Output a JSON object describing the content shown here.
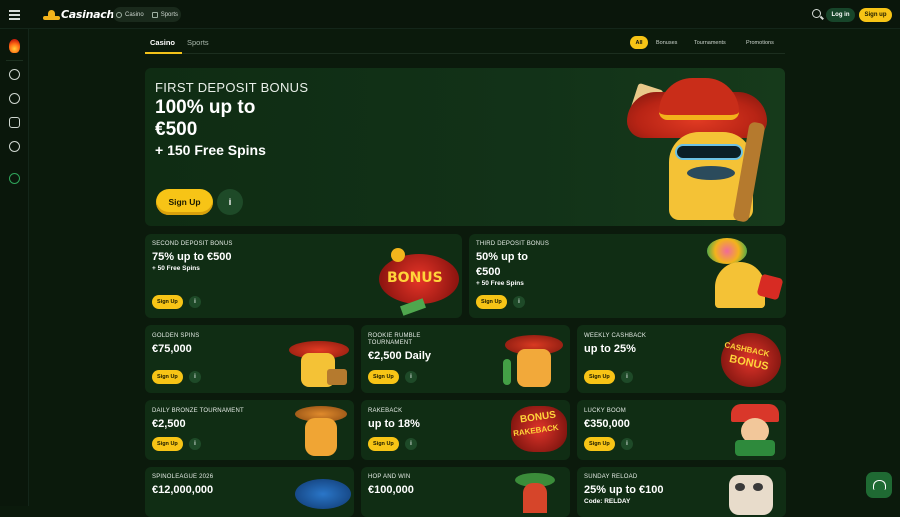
{
  "topbar": {
    "logo_text": "Casinacho",
    "seg_casino": "Casino",
    "seg_sports": "Sports",
    "login_label": "Log in",
    "signup_label": "Sign up"
  },
  "subnav": {
    "tab_casino": "Casino",
    "tab_sports": "Sports",
    "filters": [
      "All",
      "Bonuses",
      "Tournaments",
      "Promotions"
    ]
  },
  "hero": {
    "title": "FIRST DEPOSIT BONUS",
    "amount_line1": "100% up to",
    "amount_line2": "€500",
    "extra": "+ 150 Free Spins",
    "cta": "Sign Up"
  },
  "cards": [
    {
      "title": "SECOND DEPOSIT BONUS",
      "amount": "75% up to €500",
      "sub": "+ 50 Free Spins",
      "cta": "Sign Up"
    },
    {
      "title": "THIRD DEPOSIT BONUS",
      "amount_line1": "50% up to",
      "amount_line2": "€500",
      "sub": "+ 50 Free Spins",
      "cta": "Sign Up"
    },
    {
      "title": "GOLDEN SPINS",
      "amount": "€75,000",
      "cta": "Sign Up"
    },
    {
      "title_line1": "ROOKIE RUMBLE",
      "title_line2": "TOURNAMENT",
      "amount": "€2,500 Daily",
      "cta": "Sign Up"
    },
    {
      "title": "WEEKLY CASHBACK",
      "amount": "up to 25%",
      "cta": "Sign Up",
      "art_text_1": "CASHBACK",
      "art_text_2": "BONUS"
    },
    {
      "title": "DAILY BRONZE TOURNAMENT",
      "amount": "€2,500",
      "cta": "Sign Up"
    },
    {
      "title": "RAKEBACK",
      "amount": "up to 18%",
      "cta": "Sign Up",
      "art_text_1": "BONUS",
      "art_text_2": "RAKEBACK"
    },
    {
      "title": "LUCKY BOOM",
      "amount": "€350,000",
      "cta": "Sign Up"
    },
    {
      "title": "SPINOLEAGUE 2026",
      "amount": "€12,000,000"
    },
    {
      "title": "HOP AND WIN",
      "amount": "€100,000"
    },
    {
      "title": "SUNDAY RELOAD",
      "amount": "25% up to €100",
      "sub": "Code: RELDAY"
    }
  ],
  "bonus_art_text": "BONUS",
  "info_glyph": "i",
  "colors": {
    "accent": "#f7c416",
    "card_bg": "#102d14",
    "page_bg": "#0b1a0c"
  }
}
